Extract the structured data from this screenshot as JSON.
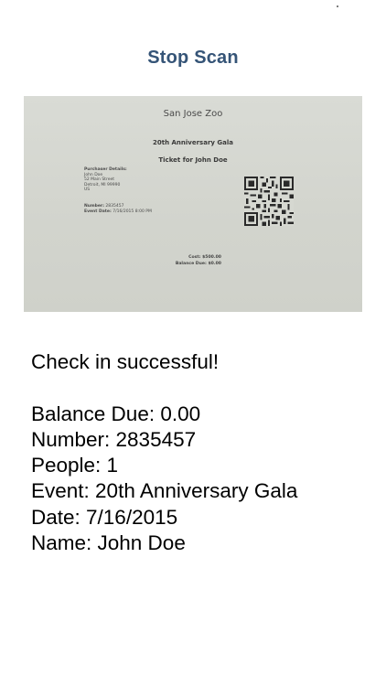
{
  "header": {
    "stop_scan_label": "Stop Scan"
  },
  "scanned_ticket": {
    "venue": "San Jose Zoo",
    "event_title": "20th Anniversary Gala",
    "ticket_for": "Ticket for John Doe",
    "purchaser_header": "Purchaser Details:",
    "purchaser_name": "John Doe",
    "purchaser_street": "52 Main Street",
    "purchaser_city": "Detroit, MI 99990",
    "purchaser_country": "US",
    "number_label": "Number:",
    "number_value": "2835457",
    "event_date_label": "Event Date:",
    "event_date_value": "7/16/2015 8:00 PM",
    "cost_label": "Cost:",
    "cost_value": "$500.00",
    "balance_label": "Balance Due:",
    "balance_value": "$0.00"
  },
  "result": {
    "status": "Check in successful!",
    "balance_due": "Balance Due: 0.00",
    "number": "Number: 2835457",
    "people": "People: 1",
    "event": "Event: 20th Anniversary Gala",
    "date": "Date: 7/16/2015",
    "name": "Name: John Doe"
  },
  "colors": {
    "accent": "#355477",
    "camera_bg": "#d4d6cf"
  },
  "icons": {
    "qr": "qr-code-icon"
  }
}
